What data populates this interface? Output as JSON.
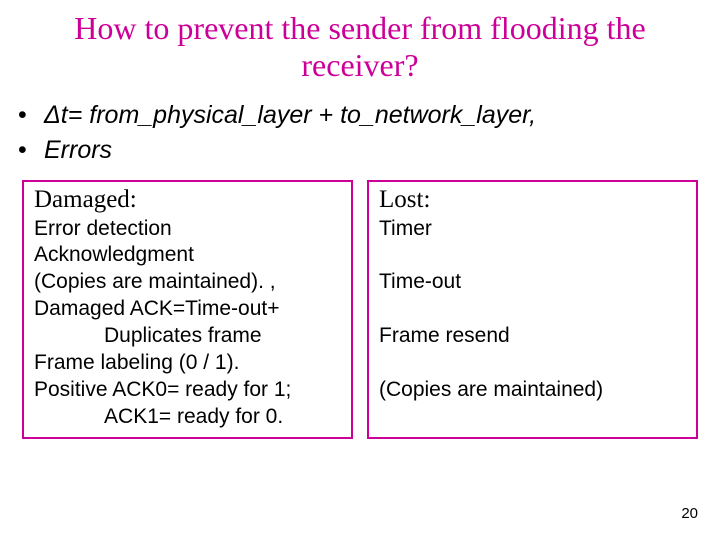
{
  "title": "How to prevent the sender from flooding the receiver?",
  "bullets": [
    "Δt= from_physical_layer + to_network_layer,",
    "Errors"
  ],
  "left_box": {
    "heading": "Damaged:",
    "body": "Error detection\nAcknowledgment\n(Copies are maintained). ,\nDamaged ACK=Time-out+\n            Duplicates frame\nFrame labeling (0 / 1).\nPositive ACK0= ready for 1;\n            ACK1= ready for 0."
  },
  "right_box": {
    "heading": "Lost:",
    "body": "Timer\n\nTime-out\n\nFrame resend\n\n(Copies are maintained)"
  },
  "page_number": "20"
}
